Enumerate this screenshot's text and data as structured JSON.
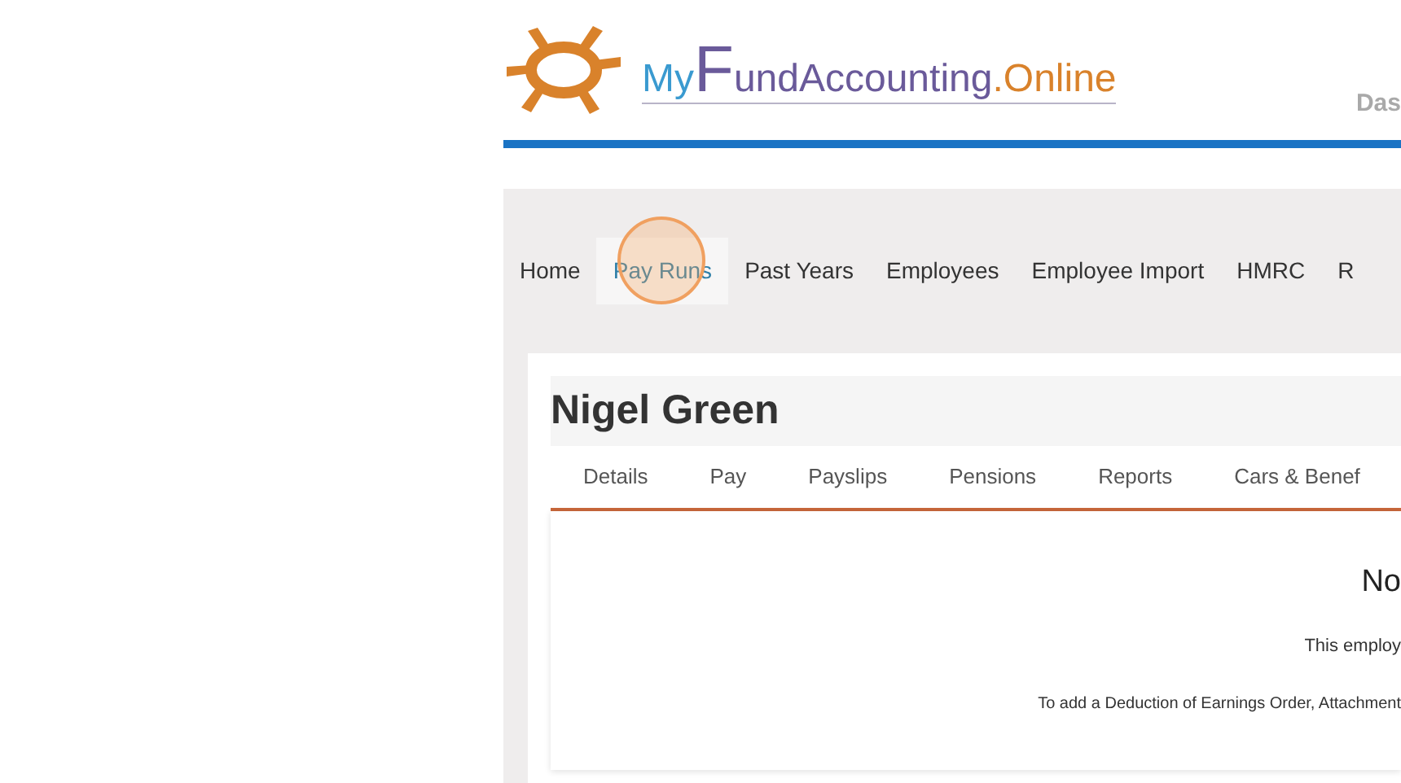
{
  "logo": {
    "parts": [
      "My",
      "F",
      "undAccounting",
      ".Online"
    ]
  },
  "header_link": "Das",
  "nav": [
    {
      "label": "Home",
      "selected": false
    },
    {
      "label": "Pay Runs",
      "selected": true
    },
    {
      "label": "Past Years",
      "selected": false
    },
    {
      "label": "Employees",
      "selected": false
    },
    {
      "label": "Employee Import",
      "selected": false
    },
    {
      "label": "HMRC",
      "selected": false
    },
    {
      "label": "R",
      "selected": false
    }
  ],
  "employee": {
    "name": "Nigel Green"
  },
  "tabs": [
    {
      "label": "Details"
    },
    {
      "label": "Pay"
    },
    {
      "label": "Payslips"
    },
    {
      "label": "Pensions"
    },
    {
      "label": "Reports"
    },
    {
      "label": "Cars & Benef"
    }
  ],
  "panel": {
    "heading": "No",
    "message": "This employ",
    "hint": "To add a Deduction of Earnings Order, Attachment"
  }
}
